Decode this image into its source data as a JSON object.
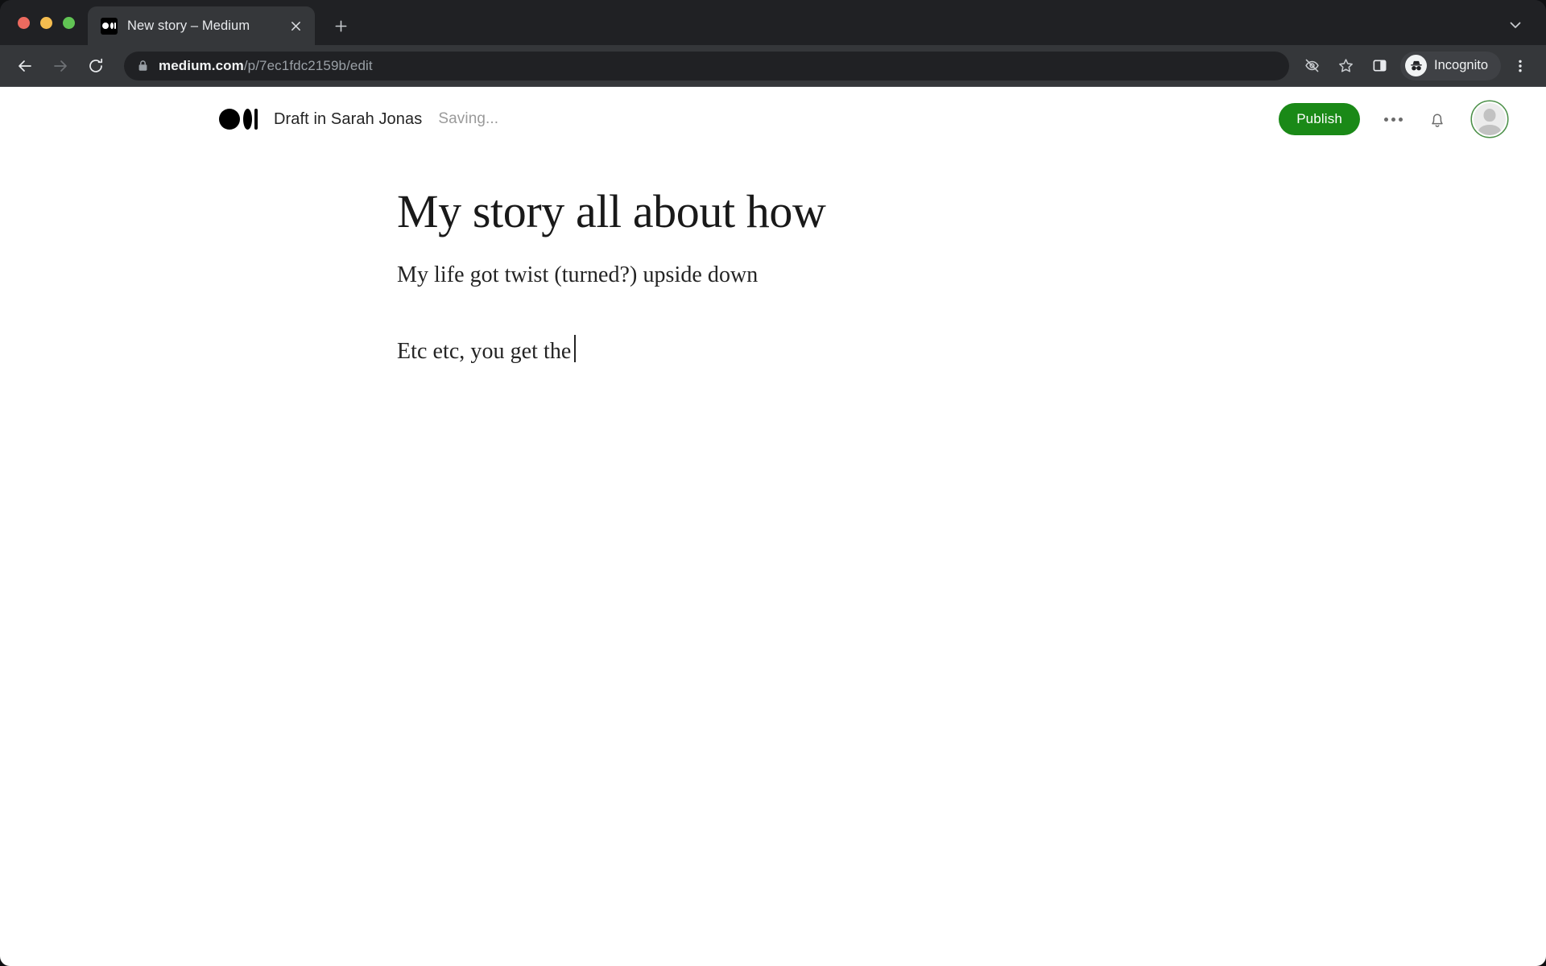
{
  "window": {
    "traffic_lights": [
      "close",
      "minimize",
      "zoom"
    ],
    "colors": {
      "close": "#ed6a5f",
      "minimize": "#f5bd4f",
      "zoom": "#61c454",
      "chrome_tabstrip_bg": "#202124",
      "chrome_toolbar_bg": "#35373a",
      "medium_green": "#1a8917",
      "page_bg": "#ffffff"
    }
  },
  "tabstrip": {
    "tabs": [
      {
        "title": "New story – Medium",
        "favicon": "medium-logo-icon",
        "active": true,
        "close_icon": "close-icon"
      }
    ],
    "new_tab_icon": "plus-icon",
    "tab_search_icon": "chevron-down-icon"
  },
  "toolbar": {
    "back_icon": "back-arrow-icon",
    "forward_icon": "forward-arrow-icon",
    "reload_icon": "reload-icon",
    "omnibox": {
      "lock_icon": "lock-icon",
      "host": "medium.com",
      "path": "/p/7ec1fdc2159b/edit",
      "full_url": "medium.com/p/7ec1fdc2159b/edit"
    },
    "tracking_protection_icon": "eye-slash-icon",
    "bookmark_icon": "star-icon",
    "side_panel_icon": "side-panel-icon",
    "profile": {
      "badge_icon": "incognito-icon",
      "label": "Incognito"
    },
    "menu_icon": "three-dot-vertical-icon"
  },
  "app_header": {
    "logo_icon": "medium-logo-icon",
    "draft_label": "Draft in Sarah Jonas",
    "save_status": "Saving...",
    "publish_label": "Publish",
    "more_options_icon": "three-dot-horizontal-icon",
    "notifications_icon": "bell-icon",
    "avatar_icon": "avatar-placeholder-icon"
  },
  "editor": {
    "title": "My story all about how",
    "subtitle": "My life got twist (turned?) upside down",
    "paragraph": "Etc etc, you get the",
    "caret_visible": true
  }
}
